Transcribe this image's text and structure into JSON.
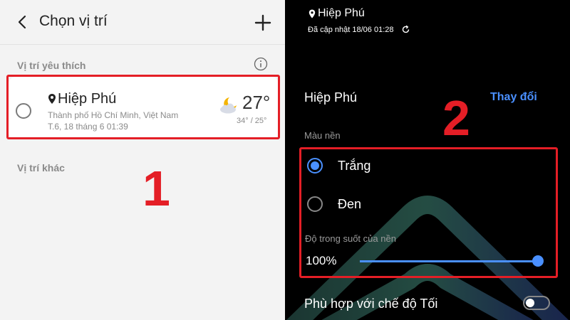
{
  "left": {
    "header": {
      "title": "Chọn vị trí",
      "back_icon": "back-arrow-icon",
      "add_icon": "plus-icon"
    },
    "favorites": {
      "section_label": "Vị trí yêu thích",
      "info_icon": "info-icon",
      "card": {
        "name": "Hiệp Phú",
        "subtitle": "Thành phố Hồ Chí Minh, Việt Nam",
        "time": "T.6, 18 tháng 6 01:39",
        "weather_icon": "moon-cloud-icon",
        "temperature": "27°",
        "range": "34° / 25°"
      }
    },
    "other": {
      "section_label": "Vị trí khác"
    },
    "annotation": "1"
  },
  "right": {
    "widget": {
      "title": "Hiệp Phú",
      "updated": "Đã cập nhật 18/06 01:28"
    },
    "location": {
      "name": "Hiệp Phú",
      "change_label": "Thay đổi"
    },
    "annotation": "2",
    "background": {
      "label": "Màu nền",
      "options": [
        "Trắng",
        "Đen"
      ],
      "selected": "Trắng"
    },
    "opacity": {
      "label": "Độ trong suốt của nền",
      "value": "100%",
      "level": 1.0
    },
    "dark_mode": {
      "label": "Phù hợp với chế độ Tối",
      "enabled": false
    }
  },
  "colors": {
    "accent": "#4a90ff",
    "highlight": "#e41e26"
  }
}
